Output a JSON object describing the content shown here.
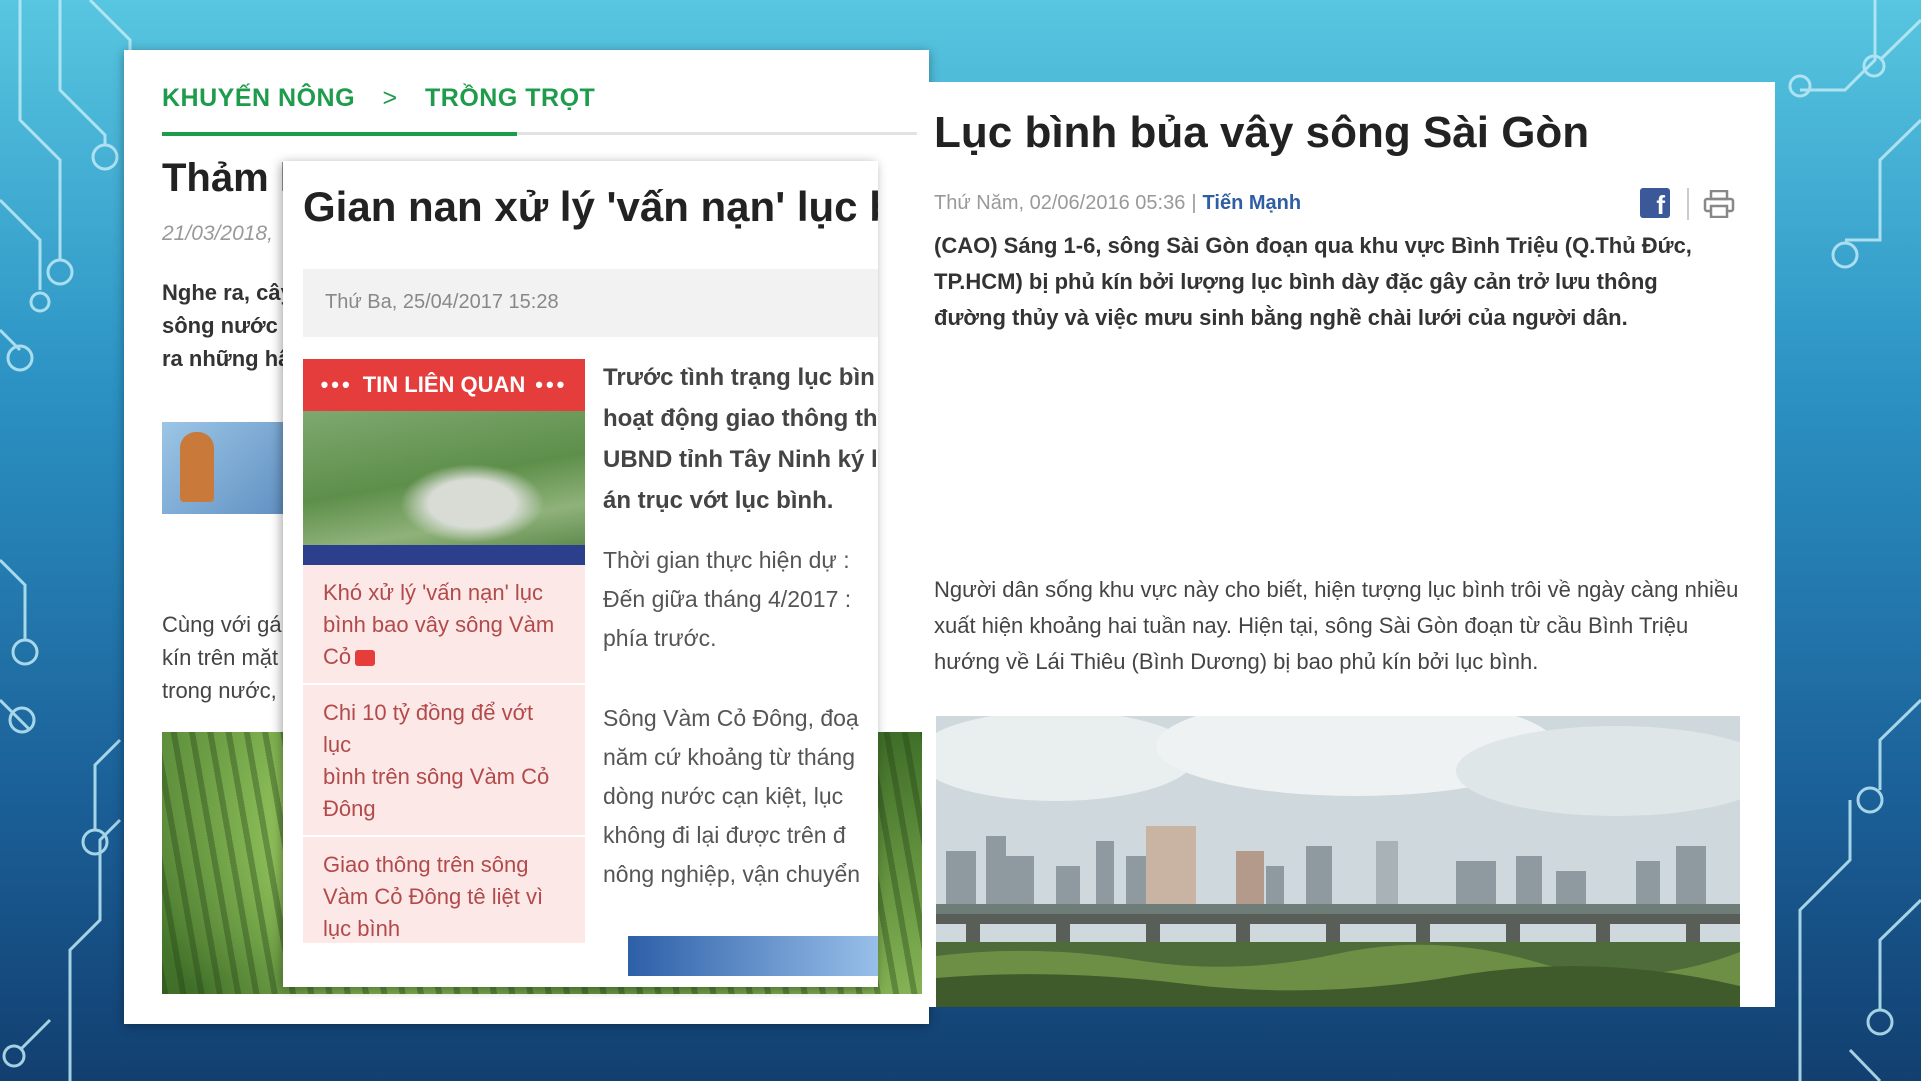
{
  "back_article": {
    "breadcrumb_1": "KHUYẾN NÔNG",
    "breadcrumb_sep": ">",
    "breadcrumb_2": "TRỒNG TRỌT",
    "title": "Thảm h",
    "date": "21/03/2018,",
    "lead": [
      "Nghe ra, cây",
      "sông nước b",
      "ra những hậ"
    ],
    "body": [
      "Cùng với gá",
      "kín trên mặt",
      "trong nước,"
    ]
  },
  "mid_article": {
    "title": "Gian nan xử lý 'vấn nạn' lục bình t",
    "date": "Thứ Ba, 25/04/2017 15:28",
    "related_header": "TIN LIÊN QUAN",
    "related_items": [
      [
        "Khó xử lý 'vấn nạn' lục",
        "bình bao vây sông Vàm",
        "Cỏ"
      ],
      [
        "Chi 10 tỷ đồng để vớt lục",
        "bình trên sông Vàm Cỏ",
        "Đông"
      ],
      [
        "Giao thông trên sông",
        "Vàm Cỏ Đông tê liệt vì",
        "lục bình"
      ]
    ],
    "lead": [
      "Trước tình trạng lục bìn",
      "hoạt động giao thông th",
      "UBND tỉnh Tây Ninh ký l",
      "án trục vớt lục bình."
    ],
    "para1": [
      "Thời gian thực hiện dự :",
      "Đến giữa tháng 4/2017 :",
      "phía trước."
    ],
    "para2": [
      "Sông Vàm Cỏ Đông, đoạ",
      "năm cứ khoảng từ tháng",
      "dòng nước cạn kiệt, lục",
      "không đi lại được trên đ",
      "nông nghiệp, vận chuyển"
    ]
  },
  "right_article": {
    "title": "Lục bình bủa vây sông Sài Gòn",
    "date": "Thứ Năm, 02/06/2016 05:36",
    "separator": "|",
    "author": "Tiến Mạnh",
    "lead": "(CAO) Sáng 1-6, sông Sài Gòn đoạn qua khu vực Bình Triệu (Q.Thủ Đức, TP.HCM) bị phủ kín bởi lượng lục bình dày đặc gây cản trở lưu thông đường thủy và việc mưu sinh bằng nghề chài lưới của người dân.",
    "body": "Người dân sống khu vực này cho biết, hiện tượng lục bình trôi về ngày càng nhiều xuất hiện khoảng hai tuần nay. Hiện tại, sông Sài Gòn đoạn từ cầu Bình Triệu hướng về Lái Thiêu (Bình Dương) bị bao phủ kín bởi lục bình.",
    "facebook_glyph": "f"
  },
  "colors": {
    "green_brand": "#1e9b4b",
    "related_red": "#e53c3c",
    "author_blue": "#2f5fa3",
    "facebook_blue": "#3b5998"
  }
}
